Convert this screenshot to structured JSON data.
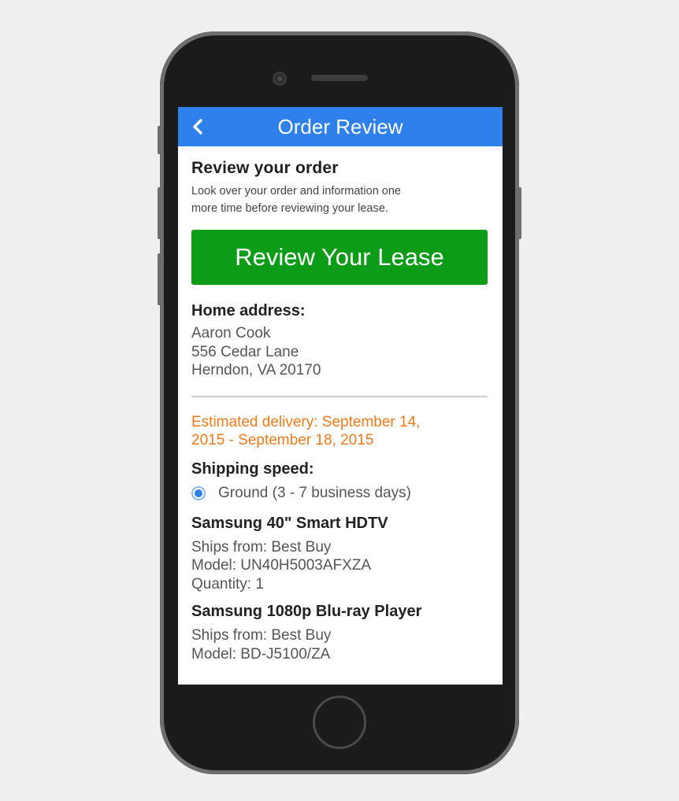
{
  "app_bar": {
    "title": "Order Review",
    "back_icon": "chevron-left-icon"
  },
  "review": {
    "heading": "Review your order",
    "description_line1": "Look over your order and information one",
    "description_line2": "more time before reviewing your lease.",
    "cta_label": "Review Your Lease"
  },
  "address": {
    "label": "Home address:",
    "name": "Aaron Cook",
    "street": "556 Cedar Lane",
    "city_state_zip": "Herndon, VA 20170"
  },
  "delivery": {
    "estimate_line1": "Estimated delivery: September 14,",
    "estimate_line2": "2015 - September 18, 2015"
  },
  "shipping": {
    "label": "Shipping speed:",
    "option": "Ground (3 - 7 business days)",
    "selected": true
  },
  "items": [
    {
      "title": "Samsung 40\" Smart HDTV",
      "ships_from": "Ships from: Best Buy",
      "model": "Model: UN40H5003AFXZA",
      "quantity": "Quantity: 1"
    },
    {
      "title": "Samsung 1080p Blu-ray Player",
      "ships_from": "Ships from: Best Buy",
      "model": "Model: BD-J5100/ZA"
    }
  ],
  "colors": {
    "app_bar": "#2f80ea",
    "cta": "#0c9c18",
    "delivery_text": "#f07a1c"
  }
}
